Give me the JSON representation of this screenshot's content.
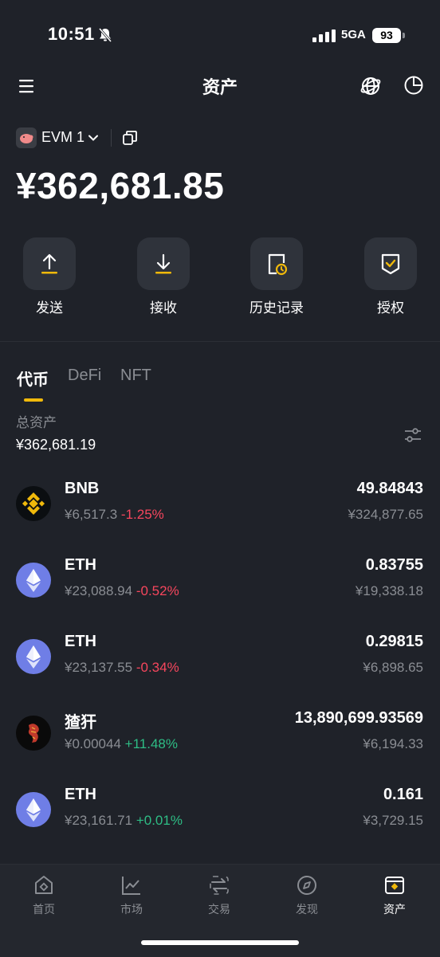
{
  "status_bar": {
    "time": "10:51",
    "network": "5GA",
    "battery": "93"
  },
  "header": {
    "title": "资产"
  },
  "wallet": {
    "name": "EVM 1",
    "balance": "¥362,681.85"
  },
  "actions": [
    {
      "label": "发送",
      "icon": "send-icon"
    },
    {
      "label": "接收",
      "icon": "receive-icon"
    },
    {
      "label": "历史记录",
      "icon": "history-icon"
    },
    {
      "label": "授权",
      "icon": "authorize-icon"
    }
  ],
  "tabs": [
    {
      "label": "代币",
      "active": true
    },
    {
      "label": "DeFi",
      "active": false
    },
    {
      "label": "NFT",
      "active": false
    }
  ],
  "summary": {
    "label": "总资产",
    "value": "¥362,681.19"
  },
  "assets": [
    {
      "name": "BNB",
      "price": "¥6,517.3",
      "change": "-1.25%",
      "amount": "49.84843",
      "value": "¥324,877.65",
      "icon": "bnb-icon"
    },
    {
      "name": "ETH",
      "price": "¥23,088.94",
      "change": "-0.52%",
      "amount": "0.83755",
      "value": "¥19,338.18",
      "icon": "eth-icon"
    },
    {
      "name": "ETH",
      "price": "¥23,137.55",
      "change": "-0.34%",
      "amount": "0.29815",
      "value": "¥6,898.65",
      "icon": "eth-icon"
    },
    {
      "name": "猹犴",
      "price": "¥0.00044",
      "change": "+11.48%",
      "amount": "13,890,699.93569",
      "value": "¥6,194.33",
      "icon": "token-icon"
    },
    {
      "name": "ETH",
      "price": "¥23,161.71",
      "change": "+0.01%",
      "amount": "0.161",
      "value": "¥3,729.15",
      "icon": "eth-icon"
    }
  ],
  "bottom_nav": [
    {
      "label": "首页",
      "icon": "home-icon",
      "active": false
    },
    {
      "label": "市场",
      "icon": "market-icon",
      "active": false
    },
    {
      "label": "交易",
      "icon": "trade-icon",
      "active": false
    },
    {
      "label": "发现",
      "icon": "discover-icon",
      "active": false
    },
    {
      "label": "资产",
      "icon": "assets-icon",
      "active": true
    }
  ],
  "colors": {
    "background": "#1f2229",
    "accent": "#f0b90b",
    "negative": "#f6465d",
    "positive": "#2ebd85",
    "eth": "#6f7ee6"
  }
}
